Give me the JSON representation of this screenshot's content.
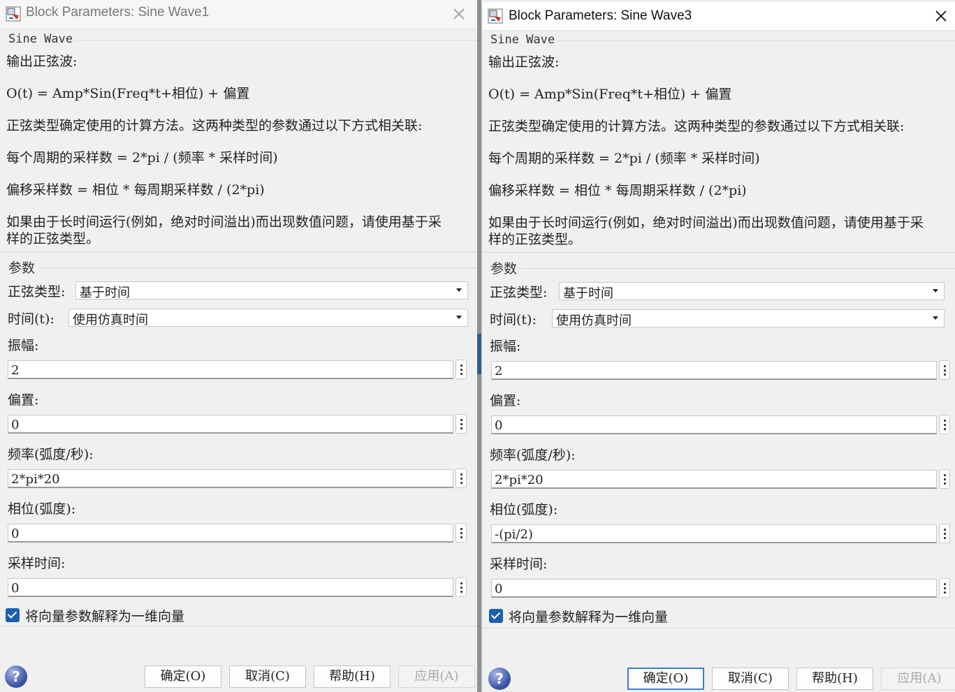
{
  "dialogs": [
    {
      "title": "Block Parameters: Sine Wave1",
      "description": {
        "legend": "Sine Wave",
        "lines": [
          "输出正弦波:",
          " O(t) = Amp*Sin(Freq*t+相位) + 偏置",
          "正弦类型确定使用的计算方法。这两种类型的参数通过以下方式相关联:",
          "每个周期的采样数 = 2*pi / (频率 * 采样时间)",
          "偏移采样数 = 相位 * 每周期采样数 / (2*pi)",
          "如果由于长时间运行(例如，绝对时间溢出)而出现数值问题，请使用基于采",
          "样的正弦类型。"
        ]
      },
      "params": {
        "legend": "参数",
        "sine_type_label": "正弦类型:",
        "sine_type_value": "基于时间",
        "time_label": "时间(t):",
        "time_value": "使用仿真时间",
        "amplitude_label": "振幅:",
        "amplitude_value": "2",
        "bias_label": "偏置:",
        "bias_value": "0",
        "frequency_label": "频率(弧度/秒):",
        "frequency_value": "2*pi*20",
        "phase_label": "相位(弧度):",
        "phase_value": "0",
        "sample_time_label": "采样时间:",
        "sample_time_value": "0",
        "interpret_vector_label": "将向量参数解释为一维向量",
        "interpret_vector_checked": true
      },
      "buttons": {
        "ok": "确定(O)",
        "cancel": "取消(C)",
        "help": "帮助(H)",
        "apply": "应用(A)"
      }
    },
    {
      "title": "Block Parameters: Sine Wave3",
      "description": {
        "legend": "Sine Wave",
        "lines": [
          "输出正弦波:",
          " O(t) = Amp*Sin(Freq*t+相位) + 偏置",
          "正弦类型确定使用的计算方法。这两种类型的参数通过以下方式相关联:",
          "每个周期的采样数 = 2*pi / (频率 * 采样时间)",
          "偏移采样数 = 相位 * 每周期采样数 / (2*pi)",
          "如果由于长时间运行(例如，绝对时间溢出)而出现数值问题，请使用基于采",
          "样的正弦类型。"
        ]
      },
      "params": {
        "legend": "参数",
        "sine_type_label": "正弦类型:",
        "sine_type_value": "基于时间",
        "time_label": "时间(t):",
        "time_value": "使用仿真时间",
        "amplitude_label": "振幅:",
        "amplitude_value": "2",
        "bias_label": "偏置:",
        "bias_value": "0",
        "frequency_label": "频率(弧度/秒):",
        "frequency_value": "2*pi*20",
        "phase_label": "相位(弧度):",
        "phase_value": "-(pi/2)",
        "sample_time_label": "采样时间:",
        "sample_time_value": "0",
        "interpret_vector_label": "将向量参数解释为一维向量",
        "interpret_vector_checked": true
      },
      "buttons": {
        "ok": "确定(O)",
        "cancel": "取消(C)",
        "help": "帮助(H)",
        "apply": "应用(A)"
      }
    }
  ],
  "colors": {
    "checkbox": "#1b5fae",
    "default_button_border": "#3c7fd1",
    "dialog_bg": "#f0f0f0"
  }
}
